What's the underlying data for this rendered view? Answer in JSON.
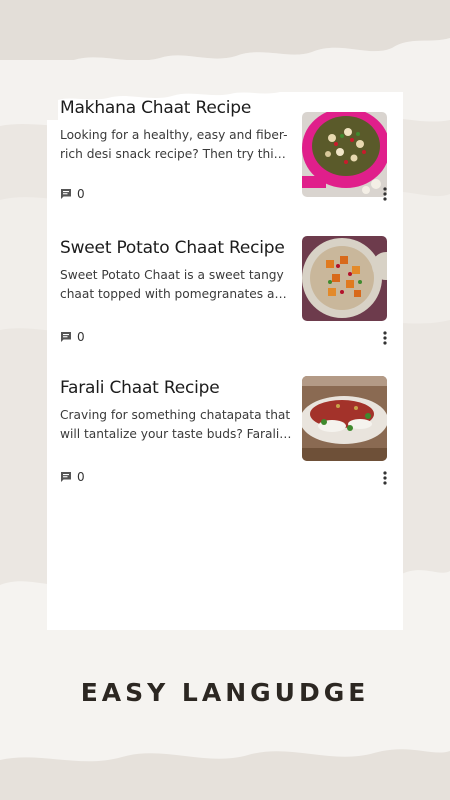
{
  "posts": [
    {
      "title": "Makhana Chaat Recipe",
      "excerpt": "Looking for a healthy, easy and fiber-rich desi snack recipe? Then try this Makhana Chaat recipe",
      "comments": "0",
      "thumb_icon": "makhana-chaat-photo"
    },
    {
      "title": "Sweet Potato Chaat Recipe",
      "excerpt": "Sweet Potato Chaat is a sweet tangy chaat topped with pomegranates and green chutney",
      "comments": "0",
      "thumb_icon": "sweet-potato-chaat-photo"
    },
    {
      "title": "Farali Chaat Recipe",
      "excerpt": "Craving for something chatapata that will tantalize your taste buds? Farali chaat is the answer",
      "comments": "0",
      "thumb_icon": "farali-chaat-photo"
    }
  ],
  "caption": "EASY LANGUDGE",
  "icons": {
    "comment": "comment-icon",
    "more": "more-vertical-icon"
  },
  "colors": {
    "background": "#ebe7e2",
    "card": "#ffffff",
    "caption_text": "#2c2722"
  }
}
